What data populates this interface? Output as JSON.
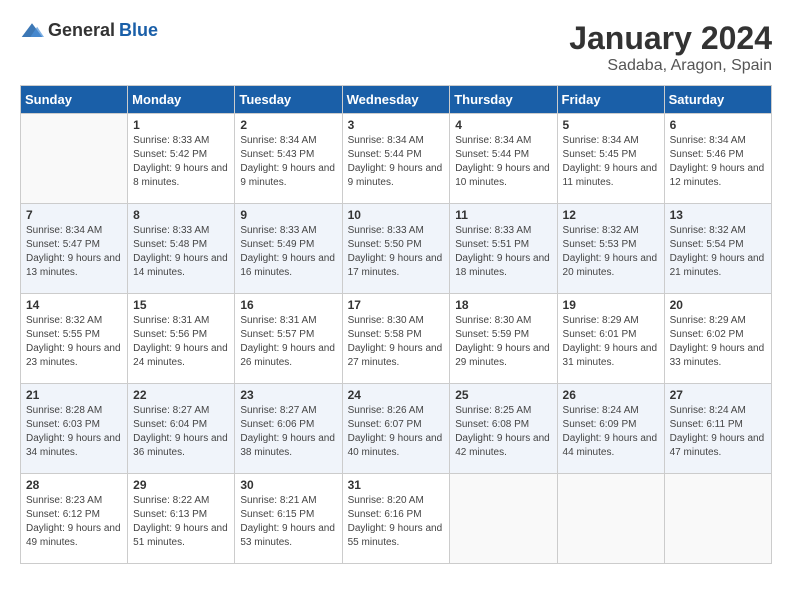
{
  "header": {
    "logo_general": "General",
    "logo_blue": "Blue",
    "month_title": "January 2024",
    "location": "Sadaba, Aragon, Spain"
  },
  "days_of_week": [
    "Sunday",
    "Monday",
    "Tuesday",
    "Wednesday",
    "Thursday",
    "Friday",
    "Saturday"
  ],
  "weeks": [
    [
      {
        "day": "",
        "sunrise": "",
        "sunset": "",
        "daylight": ""
      },
      {
        "day": "1",
        "sunrise": "Sunrise: 8:33 AM",
        "sunset": "Sunset: 5:42 PM",
        "daylight": "Daylight: 9 hours and 8 minutes."
      },
      {
        "day": "2",
        "sunrise": "Sunrise: 8:34 AM",
        "sunset": "Sunset: 5:43 PM",
        "daylight": "Daylight: 9 hours and 9 minutes."
      },
      {
        "day": "3",
        "sunrise": "Sunrise: 8:34 AM",
        "sunset": "Sunset: 5:44 PM",
        "daylight": "Daylight: 9 hours and 9 minutes."
      },
      {
        "day": "4",
        "sunrise": "Sunrise: 8:34 AM",
        "sunset": "Sunset: 5:44 PM",
        "daylight": "Daylight: 9 hours and 10 minutes."
      },
      {
        "day": "5",
        "sunrise": "Sunrise: 8:34 AM",
        "sunset": "Sunset: 5:45 PM",
        "daylight": "Daylight: 9 hours and 11 minutes."
      },
      {
        "day": "6",
        "sunrise": "Sunrise: 8:34 AM",
        "sunset": "Sunset: 5:46 PM",
        "daylight": "Daylight: 9 hours and 12 minutes."
      }
    ],
    [
      {
        "day": "7",
        "sunrise": "Sunrise: 8:34 AM",
        "sunset": "Sunset: 5:47 PM",
        "daylight": "Daylight: 9 hours and 13 minutes."
      },
      {
        "day": "8",
        "sunrise": "Sunrise: 8:33 AM",
        "sunset": "Sunset: 5:48 PM",
        "daylight": "Daylight: 9 hours and 14 minutes."
      },
      {
        "day": "9",
        "sunrise": "Sunrise: 8:33 AM",
        "sunset": "Sunset: 5:49 PM",
        "daylight": "Daylight: 9 hours and 16 minutes."
      },
      {
        "day": "10",
        "sunrise": "Sunrise: 8:33 AM",
        "sunset": "Sunset: 5:50 PM",
        "daylight": "Daylight: 9 hours and 17 minutes."
      },
      {
        "day": "11",
        "sunrise": "Sunrise: 8:33 AM",
        "sunset": "Sunset: 5:51 PM",
        "daylight": "Daylight: 9 hours and 18 minutes."
      },
      {
        "day": "12",
        "sunrise": "Sunrise: 8:32 AM",
        "sunset": "Sunset: 5:53 PM",
        "daylight": "Daylight: 9 hours and 20 minutes."
      },
      {
        "day": "13",
        "sunrise": "Sunrise: 8:32 AM",
        "sunset": "Sunset: 5:54 PM",
        "daylight": "Daylight: 9 hours and 21 minutes."
      }
    ],
    [
      {
        "day": "14",
        "sunrise": "Sunrise: 8:32 AM",
        "sunset": "Sunset: 5:55 PM",
        "daylight": "Daylight: 9 hours and 23 minutes."
      },
      {
        "day": "15",
        "sunrise": "Sunrise: 8:31 AM",
        "sunset": "Sunset: 5:56 PM",
        "daylight": "Daylight: 9 hours and 24 minutes."
      },
      {
        "day": "16",
        "sunrise": "Sunrise: 8:31 AM",
        "sunset": "Sunset: 5:57 PM",
        "daylight": "Daylight: 9 hours and 26 minutes."
      },
      {
        "day": "17",
        "sunrise": "Sunrise: 8:30 AM",
        "sunset": "Sunset: 5:58 PM",
        "daylight": "Daylight: 9 hours and 27 minutes."
      },
      {
        "day": "18",
        "sunrise": "Sunrise: 8:30 AM",
        "sunset": "Sunset: 5:59 PM",
        "daylight": "Daylight: 9 hours and 29 minutes."
      },
      {
        "day": "19",
        "sunrise": "Sunrise: 8:29 AM",
        "sunset": "Sunset: 6:01 PM",
        "daylight": "Daylight: 9 hours and 31 minutes."
      },
      {
        "day": "20",
        "sunrise": "Sunrise: 8:29 AM",
        "sunset": "Sunset: 6:02 PM",
        "daylight": "Daylight: 9 hours and 33 minutes."
      }
    ],
    [
      {
        "day": "21",
        "sunrise": "Sunrise: 8:28 AM",
        "sunset": "Sunset: 6:03 PM",
        "daylight": "Daylight: 9 hours and 34 minutes."
      },
      {
        "day": "22",
        "sunrise": "Sunrise: 8:27 AM",
        "sunset": "Sunset: 6:04 PM",
        "daylight": "Daylight: 9 hours and 36 minutes."
      },
      {
        "day": "23",
        "sunrise": "Sunrise: 8:27 AM",
        "sunset": "Sunset: 6:06 PM",
        "daylight": "Daylight: 9 hours and 38 minutes."
      },
      {
        "day": "24",
        "sunrise": "Sunrise: 8:26 AM",
        "sunset": "Sunset: 6:07 PM",
        "daylight": "Daylight: 9 hours and 40 minutes."
      },
      {
        "day": "25",
        "sunrise": "Sunrise: 8:25 AM",
        "sunset": "Sunset: 6:08 PM",
        "daylight": "Daylight: 9 hours and 42 minutes."
      },
      {
        "day": "26",
        "sunrise": "Sunrise: 8:24 AM",
        "sunset": "Sunset: 6:09 PM",
        "daylight": "Daylight: 9 hours and 44 minutes."
      },
      {
        "day": "27",
        "sunrise": "Sunrise: 8:24 AM",
        "sunset": "Sunset: 6:11 PM",
        "daylight": "Daylight: 9 hours and 47 minutes."
      }
    ],
    [
      {
        "day": "28",
        "sunrise": "Sunrise: 8:23 AM",
        "sunset": "Sunset: 6:12 PM",
        "daylight": "Daylight: 9 hours and 49 minutes."
      },
      {
        "day": "29",
        "sunrise": "Sunrise: 8:22 AM",
        "sunset": "Sunset: 6:13 PM",
        "daylight": "Daylight: 9 hours and 51 minutes."
      },
      {
        "day": "30",
        "sunrise": "Sunrise: 8:21 AM",
        "sunset": "Sunset: 6:15 PM",
        "daylight": "Daylight: 9 hours and 53 minutes."
      },
      {
        "day": "31",
        "sunrise": "Sunrise: 8:20 AM",
        "sunset": "Sunset: 6:16 PM",
        "daylight": "Daylight: 9 hours and 55 minutes."
      },
      {
        "day": "",
        "sunrise": "",
        "sunset": "",
        "daylight": ""
      },
      {
        "day": "",
        "sunrise": "",
        "sunset": "",
        "daylight": ""
      },
      {
        "day": "",
        "sunrise": "",
        "sunset": "",
        "daylight": ""
      }
    ]
  ]
}
